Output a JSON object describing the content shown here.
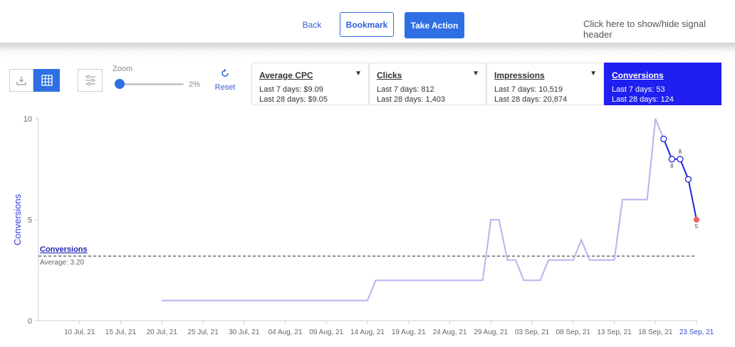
{
  "header": {
    "back_label": "Back",
    "bookmark_label": "Bookmark",
    "take_action_label": "Take Action",
    "toggle_header_text": "Click here to show/hide signal header"
  },
  "toolbar": {
    "download_icon": "download-icon",
    "table_icon": "table-icon",
    "filter_icon": "sliders-icon",
    "zoom_label": "Zoom",
    "zoom_value": "2%",
    "reset_label": "Reset",
    "reset_icon": "refresh-icon"
  },
  "metrics": [
    {
      "title": "Average CPC",
      "last7": "Last 7 days: $9.09",
      "last28": "Last 28 days: $9.05",
      "selected": false
    },
    {
      "title": "Clicks",
      "last7": "Last 7 days: 812",
      "last28": "Last 28 days: 1,403",
      "selected": false
    },
    {
      "title": "Impressions",
      "last7": "Last 7 days: 10,519",
      "last28": "Last 28 days: 20,874",
      "selected": false
    },
    {
      "title": "Conversions",
      "last7": "Last 7 days: 53",
      "last28": "Last 28 days: 124",
      "selected": true
    }
  ],
  "colors": {
    "accent": "#2f6fe4",
    "selected_card": "#1f1ff0",
    "history_line": "#b7b3f0",
    "recent_line": "#2323d9",
    "last_point": "#f06060",
    "ylabel": "#3a3ae0"
  },
  "chart_data": {
    "type": "line",
    "ylabel": "Conversions",
    "ylim": [
      0,
      10
    ],
    "yticks": [
      "0",
      "5",
      "10"
    ],
    "grid": false,
    "xticks": [
      "10 Jul, 21",
      "15 Jul, 21",
      "20 Jul, 21",
      "25 Jul, 21",
      "30 Jul, 21",
      "04 Aug, 21",
      "09 Aug, 21",
      "14 Aug, 21",
      "19 Aug, 21",
      "24 Aug, 21",
      "29 Aug, 21",
      "03 Sep, 21",
      "08 Sep, 21",
      "13 Sep, 21",
      "18 Sep, 21",
      "23 Sep, 21"
    ],
    "highlight_tick": "23 Sep, 21",
    "average": {
      "label": "Conversions",
      "text": "Average: 3.20",
      "value": 3.2
    },
    "history": {
      "x": [
        "2021-07-20",
        "2021-08-14",
        "2021-08-15",
        "2021-08-28",
        "2021-08-29",
        "2021-08-30",
        "2021-08-31",
        "2021-09-01",
        "2021-09-02",
        "2021-09-03",
        "2021-09-04",
        "2021-09-05",
        "2021-09-06",
        "2021-09-07",
        "2021-09-08",
        "2021-09-09",
        "2021-09-10",
        "2021-09-11",
        "2021-09-12",
        "2021-09-13",
        "2021-09-14",
        "2021-09-15",
        "2021-09-16",
        "2021-09-17",
        "2021-09-18",
        "2021-09-19"
      ],
      "y": [
        1,
        1,
        2,
        2,
        5,
        5,
        3,
        3,
        2,
        2,
        2,
        3,
        3,
        3,
        3,
        4,
        3,
        3,
        3,
        3,
        6,
        6,
        6,
        6,
        10,
        9
      ]
    },
    "recent": {
      "x": [
        "2021-09-19",
        "2021-09-20",
        "2021-09-21",
        "2021-09-22",
        "2021-09-23"
      ],
      "y": [
        9,
        8,
        8,
        7,
        5
      ],
      "point_labels": [
        "",
        "8",
        "8",
        "",
        "5"
      ]
    }
  }
}
